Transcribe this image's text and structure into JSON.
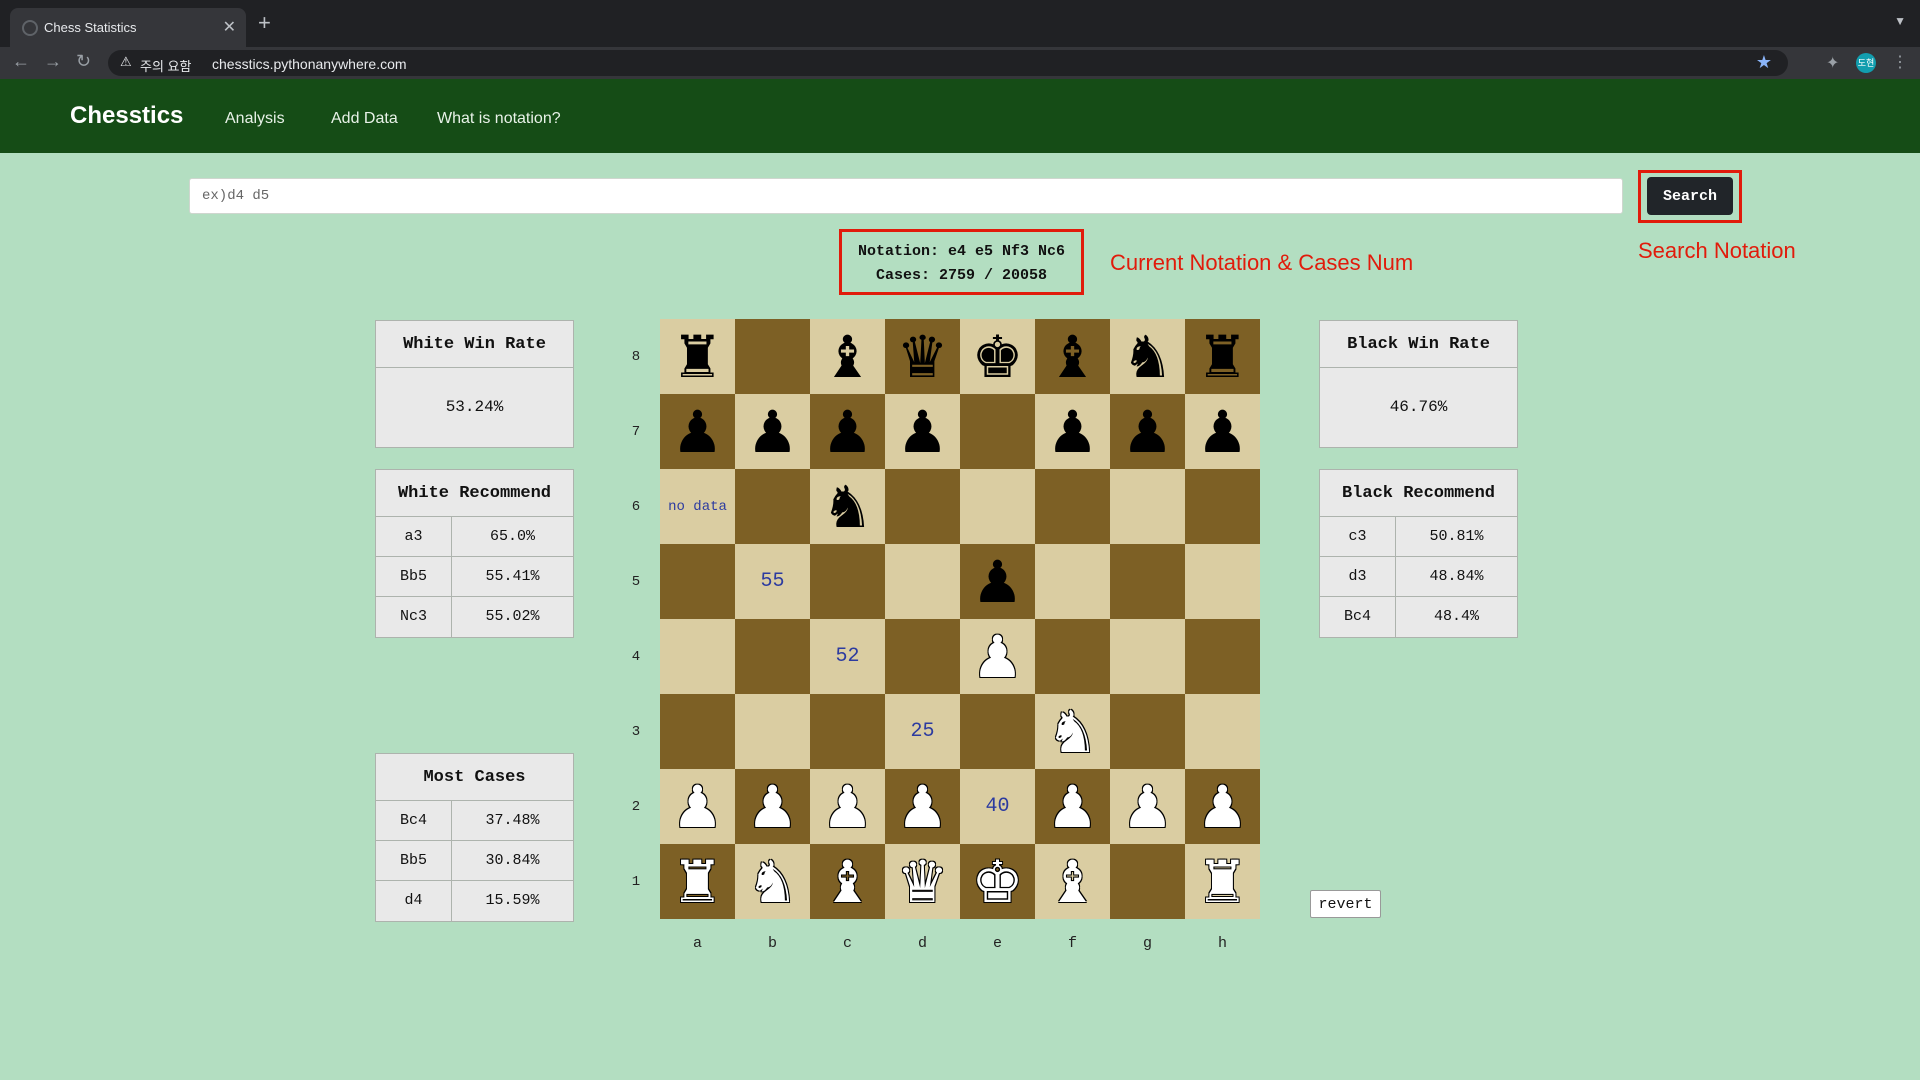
{
  "browser": {
    "tab_title": "Chess Statistics",
    "new_tab": "+",
    "security_label": "주의 요함",
    "url": "chesstics.pythonanywhere.com",
    "avatar_text": "도현"
  },
  "nav": {
    "brand": "Chesstics",
    "links": [
      "Analysis",
      "Add Data",
      "What is notation?"
    ]
  },
  "search": {
    "placeholder": "ex)d4 d5",
    "button": "Search"
  },
  "notation": {
    "line1": "Notation: e4 e5 Nf3 Nc6",
    "line2": "Cases: 2759 / 20058"
  },
  "annotations": {
    "notation": "Current Notation & Cases Num",
    "search": "Search Notation"
  },
  "white": {
    "win_rate_title": "White Win Rate",
    "win_rate": "53.24%",
    "recommend_title": "White Recommend",
    "recommend": [
      {
        "move": "a3",
        "rate": "65.0%"
      },
      {
        "move": "Bb5",
        "rate": "55.41%"
      },
      {
        "move": "Nc3",
        "rate": "55.02%"
      }
    ]
  },
  "black": {
    "win_rate_title": "Black Win Rate",
    "win_rate": "46.76%",
    "recommend_title": "Black Recommend",
    "recommend": [
      {
        "move": "c3",
        "rate": "50.81%"
      },
      {
        "move": "d3",
        "rate": "48.84%"
      },
      {
        "move": "Bc4",
        "rate": "48.4%"
      }
    ]
  },
  "most_cases": {
    "title": "Most Cases",
    "rows": [
      {
        "move": "Bc4",
        "rate": "37.48%"
      },
      {
        "move": "Bb5",
        "rate": "30.84%"
      },
      {
        "move": "d4",
        "rate": "15.59%"
      }
    ]
  },
  "board": {
    "ranks": [
      "8",
      "7",
      "6",
      "5",
      "4",
      "3",
      "2",
      "1"
    ],
    "files": [
      "a",
      "b",
      "c",
      "d",
      "e",
      "f",
      "g",
      "h"
    ],
    "squares": [
      [
        "r",
        "",
        "b",
        "q",
        "k",
        "b",
        "n",
        "r"
      ],
      [
        "p",
        "p",
        "p",
        "p",
        "",
        "p",
        "p",
        "p"
      ],
      [
        "nodata",
        "",
        "n",
        "",
        "",
        "",
        "",
        ""
      ],
      [
        "",
        "55",
        "",
        "",
        "p",
        "",
        "",
        ""
      ],
      [
        "",
        "",
        "52",
        "",
        "P",
        "",
        "",
        ""
      ],
      [
        "",
        "",
        "",
        "25",
        "",
        "N",
        "",
        ""
      ],
      [
        "P",
        "P",
        "P",
        "P",
        "40",
        "P",
        "P",
        "P"
      ],
      [
        "R",
        "N",
        "B",
        "Q",
        "K",
        "B",
        "",
        "R"
      ]
    ],
    "no_data_label": "no data"
  },
  "revert_label": "revert"
}
